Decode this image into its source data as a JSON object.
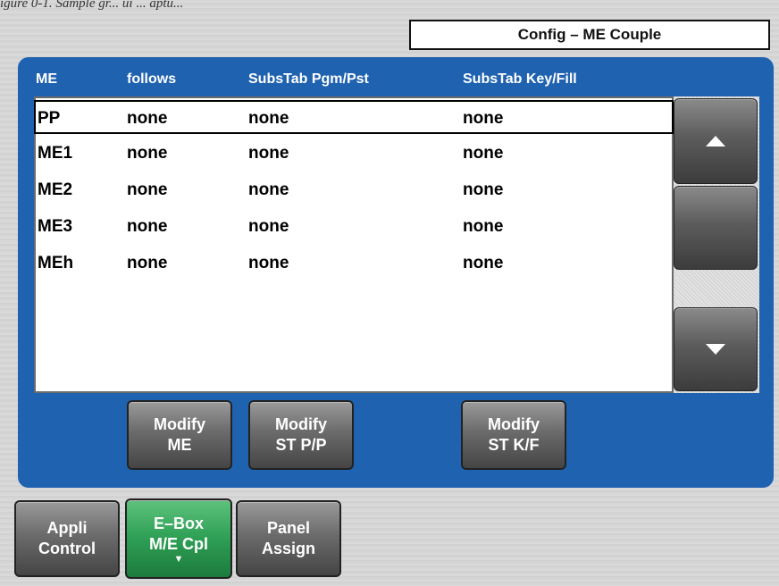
{
  "caption": "igure 0-1. Sample gr... ui ... aptu...",
  "title": "Config – ME Couple",
  "columns": [
    "ME",
    "follows",
    "SubsTab Pgm/Pst",
    "SubsTab Key/Fill"
  ],
  "rows": [
    {
      "me": "PP",
      "follows": "none",
      "pgm": "none",
      "key": "none"
    },
    {
      "me": "ME1",
      "follows": "none",
      "pgm": "none",
      "key": "none"
    },
    {
      "me": "ME2",
      "follows": "none",
      "pgm": "none",
      "key": "none"
    },
    {
      "me": "ME3",
      "follows": "none",
      "pgm": "none",
      "key": "none"
    },
    {
      "me": "MEh",
      "follows": "none",
      "pgm": "none",
      "key": "none"
    }
  ],
  "scroll": {
    "up_icon": "triangle-up",
    "down_icon": "triangle-down"
  },
  "actions": [
    {
      "line1": "Modify",
      "line2": "ME"
    },
    {
      "line1": "Modify",
      "line2": "ST P/P"
    },
    {
      "line1": "Modify",
      "line2": "ST K/F"
    }
  ],
  "tabs": [
    {
      "line1": "Appli",
      "line2": "Control"
    },
    {
      "line1": "E–Box",
      "line2": "M/E Cpl",
      "active": true
    },
    {
      "line1": "Panel",
      "line2": "Assign"
    }
  ],
  "colors": {
    "panel": "#1f62b0",
    "active_tab": "#2e9f55",
    "button": "#6b6b6b"
  }
}
